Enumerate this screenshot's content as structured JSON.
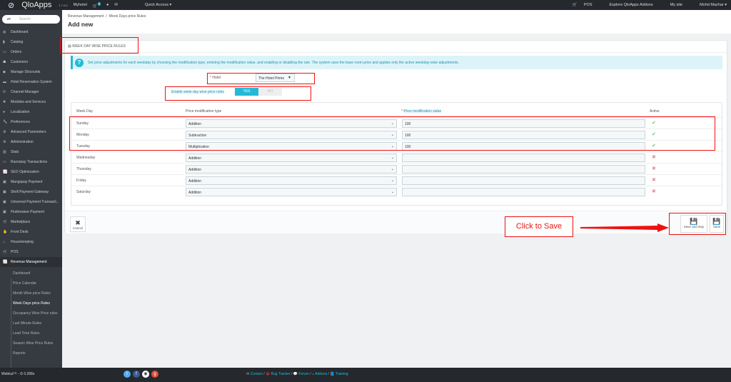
{
  "topbar": {
    "logo": "QloApps",
    "version": "1.7.0.0",
    "shop": "Myhotel",
    "cart_badge": "1",
    "quick_access": "Quick Access ▾",
    "pos": "POS",
    "addons": "Explore QloApps Addons",
    "my_site": "My site",
    "user": "Mohd Mazhar ▾"
  },
  "sidebar": {
    "search_placeholder": "Search",
    "items": [
      {
        "label": "Dashboard",
        "icon": "dashboard-icon"
      },
      {
        "label": "Catalog",
        "icon": "book-icon"
      },
      {
        "label": "Orders",
        "icon": "credit-card-icon"
      },
      {
        "label": "Customers",
        "icon": "users-icon"
      },
      {
        "label": "Manage Discounts",
        "icon": "tag-icon"
      },
      {
        "label": "Hotel Reservation System",
        "icon": "bed-icon"
      },
      {
        "label": "Channel Manager",
        "icon": "refresh-icon"
      },
      {
        "label": "Modules and Services",
        "icon": "puzzle-icon"
      },
      {
        "label": "Localization",
        "icon": "globe-icon"
      },
      {
        "label": "Preferences",
        "icon": "wrench-icon"
      },
      {
        "label": "Advanced Parameters",
        "icon": "cogs-icon"
      },
      {
        "label": "Administration",
        "icon": "gear-icon"
      },
      {
        "label": "Stats",
        "icon": "bar-chart-icon"
      },
      {
        "label": "Razorpay Transactions",
        "icon": "credit-card-icon"
      },
      {
        "label": "SEO Optimization",
        "icon": "line-chart-icon"
      },
      {
        "label": "Mangopay Payment",
        "icon": "money-icon"
      },
      {
        "label": "Skrill Payment Gateway",
        "icon": "money-icon"
      },
      {
        "label": "Universal Payment Transacti...",
        "icon": "money-icon"
      },
      {
        "label": "Flutterwave Payment",
        "icon": "money-icon"
      },
      {
        "label": "Marketplace",
        "icon": "cart-icon"
      },
      {
        "label": "Front Desk",
        "icon": "hand-icon"
      },
      {
        "label": "Housekeeping",
        "icon": "home-icon"
      },
      {
        "label": "POS",
        "icon": "cart-icon"
      },
      {
        "label": "Revenue Management",
        "icon": "line-chart-icon"
      }
    ],
    "subitems": [
      "Dashboard",
      "Price Calendar",
      "Month Wise price Rules",
      "Week Days price Rules",
      "Occupancy Wise Price rules",
      "Last Minute Rules",
      "Lead Time Rules",
      "Season Wise Price Rules",
      "Reports"
    ]
  },
  "header": {
    "breadcrumb": [
      "Revenue Management",
      "Week Days price Rules"
    ],
    "title": "Add new"
  },
  "panel": {
    "heading": "Week Day Wise Price Rules",
    "info": "Set price adjustments for each weekday by choosing the modification type, entering the modification value, and enabling or disabling the rule. The system uses the base room price and applies only the active weekday-wise adjustments.",
    "hotel_label": "Hotel",
    "hotel_value": "The Hotel Prime",
    "enable_label": "Enable week day wise price rules",
    "yes": "YES",
    "no": "NO",
    "columns": [
      "Week Day",
      "Price modification type",
      "Price modification value",
      "Active"
    ],
    "rows": [
      {
        "day": "Sunday",
        "type": "Addition",
        "value": "100",
        "active": true
      },
      {
        "day": "Monday",
        "type": "Subtraction",
        "value": "100",
        "active": true
      },
      {
        "day": "Tuesday",
        "type": "Multiplication",
        "value": "100",
        "active": true
      },
      {
        "day": "Wednesday",
        "type": "Addition",
        "value": "",
        "active": false
      },
      {
        "day": "Thursday",
        "type": "Addition",
        "value": "",
        "active": false
      },
      {
        "day": "Friday",
        "type": "Addition",
        "value": "",
        "active": false
      },
      {
        "day": "Saturday",
        "type": "Addition",
        "value": "",
        "active": false
      }
    ],
    "cancel": "Cancel",
    "save_and_stay": "Save and stay",
    "save": "Save"
  },
  "annotation": {
    "text": "Click to Save",
    "color": "#e11111"
  },
  "footer": {
    "version": "Webkul™ - ⏱ 0.268s",
    "links": [
      "Contact",
      "Bug Tracker",
      "Forum",
      "Addons",
      "Training"
    ]
  }
}
